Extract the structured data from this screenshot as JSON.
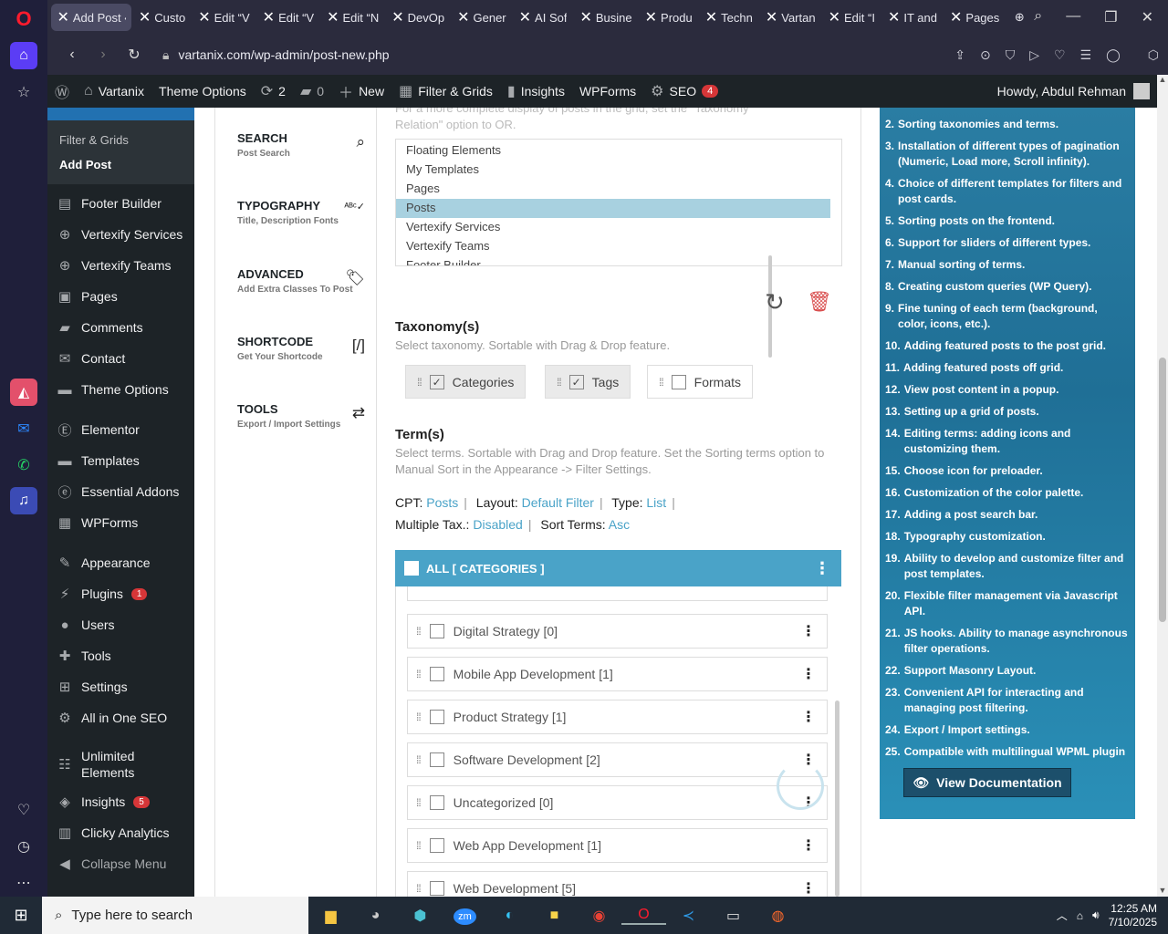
{
  "browser": {
    "tabs": [
      {
        "label": "Add Post ‹",
        "active": true
      },
      {
        "label": "Custo"
      },
      {
        "label": "Edit “V"
      },
      {
        "label": "Edit “V"
      },
      {
        "label": "Edit “N"
      },
      {
        "label": "DevOp"
      },
      {
        "label": "Gener"
      },
      {
        "label": "AI Sof"
      },
      {
        "label": "Busine"
      },
      {
        "label": "Produ"
      },
      {
        "label": "Techn"
      },
      {
        "label": "Vartan"
      },
      {
        "label": "Edit “I"
      },
      {
        "label": "IT and"
      },
      {
        "label": "Pages"
      }
    ],
    "url": "vartanix.com/wp-admin/post-new.php"
  },
  "adminbar": {
    "site": "Vartanix",
    "theme_options": "Theme Options",
    "updates": "2",
    "comments": "0",
    "new": "New",
    "filter_grids": "Filter & Grids",
    "insights": "Insights",
    "wpforms": "WPForms",
    "seo": "SEO",
    "seo_count": "4",
    "howdy": "Howdy, Abdul Rehman"
  },
  "sidebar": {
    "head": "Filter & Grids",
    "sub": [
      "Filter & Grids",
      "Add Post"
    ],
    "items": [
      {
        "label": "Footer Builder",
        "icon": "grid-icon"
      },
      {
        "label": "Vertexify Services",
        "icon": "plus-circle-icon"
      },
      {
        "label": "Vertexify Teams",
        "icon": "plus-circle-icon"
      },
      {
        "label": "Pages",
        "icon": "pages-icon"
      },
      {
        "label": "Comments",
        "icon": "comment-icon"
      },
      {
        "label": "Contact",
        "icon": "mail-icon"
      },
      {
        "label": "Theme Options",
        "icon": "folder-icon"
      },
      {
        "label": "Elementor",
        "icon": "elementor-icon"
      },
      {
        "label": "Templates",
        "icon": "folder-icon"
      },
      {
        "label": "Essential Addons",
        "icon": "ea-icon"
      },
      {
        "label": "WPForms",
        "icon": "form-icon"
      },
      {
        "label": "Appearance",
        "icon": "brush-icon"
      },
      {
        "label": "Plugins",
        "icon": "plug-icon",
        "badge": "1"
      },
      {
        "label": "Users",
        "icon": "user-icon"
      },
      {
        "label": "Tools",
        "icon": "wrench-icon"
      },
      {
        "label": "Settings",
        "icon": "settings-icon"
      },
      {
        "label": "All in One SEO",
        "icon": "seo-icon"
      },
      {
        "label": "Unlimited Elements",
        "icon": "ue-icon"
      },
      {
        "label": "Insights",
        "icon": "insights-icon",
        "badge": "5"
      },
      {
        "label": "Clicky Analytics",
        "icon": "chart-icon"
      },
      {
        "label": "Collapse Menu",
        "icon": "collapse-icon"
      }
    ]
  },
  "settings_nav": [
    {
      "title": "SEARCH",
      "sub": "Post Search"
    },
    {
      "title": "TYPOGRAPHY",
      "sub": "Title, Description Fonts"
    },
    {
      "title": "ADVANCED",
      "sub": "Add Extra Classes To Post"
    },
    {
      "title": "SHORTCODE",
      "sub": "Get Your Shortcode"
    },
    {
      "title": "TOOLS",
      "sub": "Export / Import Settings"
    }
  ],
  "cpt": {
    "intro_1": "For a more complete display of posts in the grid, set the \"Taxonomy",
    "intro_2": "Relation\" option to OR.",
    "options": [
      "Floating Elements",
      "My Templates",
      "Pages",
      "Posts",
      "Vertexify Services",
      "Vertexify Teams",
      "Footer Builder"
    ],
    "selected": "Posts"
  },
  "taxonomy": {
    "title": "Taxonomy(s)",
    "desc": "Select taxonomy. Sortable with Drag & Drop feature.",
    "items": [
      {
        "label": "Categories",
        "checked": true
      },
      {
        "label": "Tags",
        "checked": true
      },
      {
        "label": "Formats",
        "checked": false
      }
    ]
  },
  "terms": {
    "title": "Term(s)",
    "desc": "Select terms. Sortable with Drag and Drop feature. Set the Sorting terms option to Manual Sort in the Appearance -> Filter Settings.",
    "cpt_label": "CPT:",
    "cpt_value": "Posts",
    "layout_label": "Layout:",
    "layout_value": "Default Filter",
    "type_label": "Type:",
    "type_value": "List",
    "multi_label": "Multiple Tax.:",
    "multi_value": "Disabled",
    "sort_label": "Sort Terms:",
    "sort_value": "Asc",
    "header": "ALL [ CATEGORIES ]",
    "rows": [
      "Digital Strategy [0]",
      "Mobile App Development [1]",
      "Product Strategy [1]",
      "Software Development [2]",
      "Uncategorized [0]",
      "Web App Development [1]",
      "Web Development [5]"
    ]
  },
  "docs": {
    "items": [
      "Sorting taxonomies and terms.",
      "Installation of different types of pagination (Numeric, Load more, Scroll infinity).",
      "Choice of different templates for filters and post cards.",
      "Sorting posts on the frontend.",
      "Support for sliders of different types.",
      "Manual sorting of terms.",
      "Creating custom queries (WP Query).",
      "Fine tuning of each term (background, color, icons, etc.).",
      "Adding featured posts to the post grid.",
      "Adding featured posts off grid.",
      "View post content in a popup.",
      "Setting up a grid of posts.",
      "Editing terms: adding icons and customizing them.",
      "Choose icon for preloader.",
      "Customization of the color palette.",
      "Adding a post search bar.",
      "Typography customization.",
      "Ability to develop and customize filter and post templates.",
      "Flexible filter management via Javascript API.",
      "JS hooks. Ability to manage asynchronous filter operations.",
      "Support Masonry Layout.",
      "Convenient API for interacting and managing post filtering.",
      "Export / Import settings.",
      "Compatible with multilingual WPML plugin"
    ],
    "start_number": 2,
    "button": "View Documentation"
  },
  "taskbar": {
    "search_placeholder": "Type here to search",
    "time": "12:25 AM",
    "date": "7/10/2025"
  },
  "colors": {
    "accent": "#4aa3c8",
    "wp_dark": "#1d2327",
    "danger": "#d63638",
    "docs_bg": "#2a7da3"
  }
}
